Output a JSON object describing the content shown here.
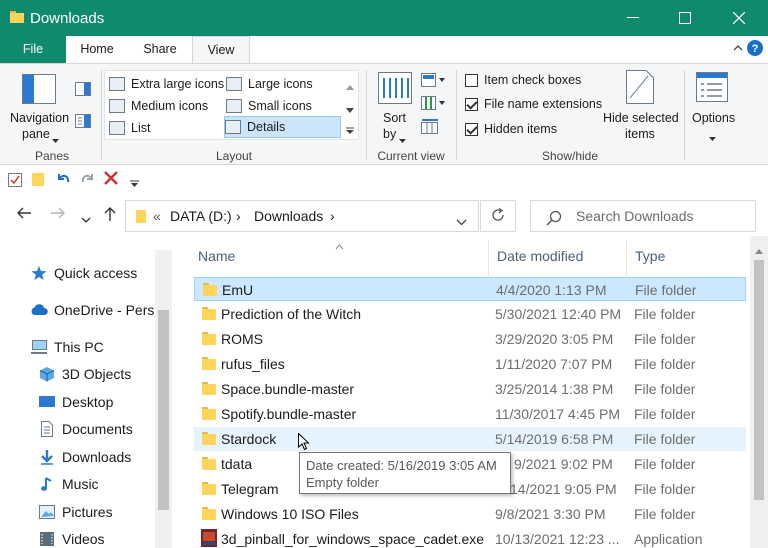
{
  "window": {
    "title": "Downloads"
  },
  "colors": {
    "titlebar": "#0f8a6e",
    "selection": "#cce8ff",
    "hover": "#e5f3ff",
    "folder": "#ffd45a"
  },
  "ribbon_tabs": [
    "File",
    "Home",
    "Share",
    "View"
  ],
  "ribbon": {
    "panes": {
      "navigation_pane_line1": "Navigation",
      "navigation_pane_line2": "pane",
      "group_label": "Panes"
    },
    "layout": {
      "items": [
        "Extra large icons",
        "Large icons",
        "Medium icons",
        "Small icons",
        "List",
        "Details"
      ],
      "selected": "Details",
      "group_label": "Layout"
    },
    "current_view": {
      "sort_line1": "Sort",
      "sort_line2": "by",
      "group_label": "Current view"
    },
    "show_hide": {
      "item_check_boxes": {
        "label": "Item check boxes",
        "checked": false
      },
      "file_name_extensions": {
        "label": "File name extensions",
        "checked": true
      },
      "hidden_items": {
        "label": "Hidden items",
        "checked": true
      },
      "hide_selected_line1": "Hide selected",
      "hide_selected_line2": "items",
      "group_label": "Show/hide"
    },
    "options": {
      "label": "Options"
    }
  },
  "address": {
    "chevrons": "«",
    "drive": "DATA (D:)",
    "sep": "›",
    "folder": "Downloads",
    "sep2": "›"
  },
  "search": {
    "placeholder": "Search Downloads"
  },
  "nav": {
    "items": [
      {
        "label": "Quick access",
        "icon": "star-icon"
      },
      {
        "label": "OneDrive - Perso",
        "icon": "cloud-icon"
      },
      {
        "label": "This PC",
        "icon": "computer-icon"
      },
      {
        "label": "3D Objects",
        "icon": "cube-icon"
      },
      {
        "label": "Desktop",
        "icon": "desktop-icon"
      },
      {
        "label": "Documents",
        "icon": "document-icon"
      },
      {
        "label": "Downloads",
        "icon": "download-arrow-icon"
      },
      {
        "label": "Music",
        "icon": "music-note-icon"
      },
      {
        "label": "Pictures",
        "icon": "picture-icon"
      },
      {
        "label": "Videos",
        "icon": "film-icon"
      }
    ]
  },
  "columns": {
    "name": "Name",
    "date": "Date modified",
    "type": "Type"
  },
  "files": [
    {
      "name": "EmU",
      "date": "4/4/2020 1:13 PM",
      "type": "File folder"
    },
    {
      "name": "Prediction of the Witch",
      "date": "5/30/2021 12:40 PM",
      "type": "File folder"
    },
    {
      "name": "ROMS",
      "date": "3/29/2020 3:05 PM",
      "type": "File folder"
    },
    {
      "name": "rufus_files",
      "date": "1/11/2020 7:07 PM",
      "type": "File folder"
    },
    {
      "name": "Space.bundle-master",
      "date": "3/25/2014 1:38 PM",
      "type": "File folder"
    },
    {
      "name": "Spotify.bundle-master",
      "date": "11/30/2017 4:45 PM",
      "type": "File folder"
    },
    {
      "name": "Stardock",
      "date": "5/14/2019 6:58 PM",
      "type": "File folder"
    },
    {
      "name": "tdata",
      "date": "9/2021 9:02 PM",
      "type": "File folder"
    },
    {
      "name": "Telegram",
      "date": "14/2021 9:05 PM",
      "type": "File folder"
    },
    {
      "name": "Windows 10 ISO Files",
      "date": "9/8/2021 3:30 PM",
      "type": "File folder"
    },
    {
      "name": "3d_pinball_for_windows_space_cadet.exe",
      "date": "10/13/2021 12:23 ...",
      "type": "Application"
    }
  ],
  "tooltip": {
    "line1": "Date created: 5/16/2019 3:05 AM",
    "line2": "Empty folder"
  }
}
